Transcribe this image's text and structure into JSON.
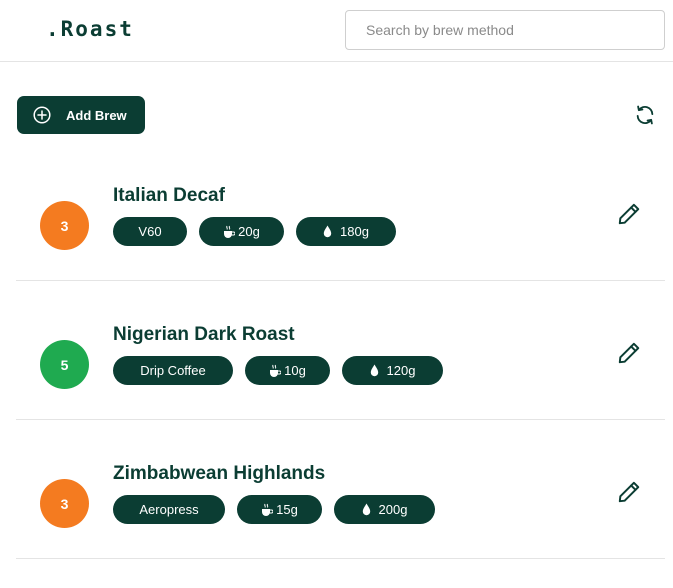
{
  "header": {
    "logo": ".Roast",
    "search_placeholder": "Search by brew method"
  },
  "toolbar": {
    "add_label": "Add Brew",
    "add_icon": "plus-circle-icon",
    "refresh_icon": "refresh-icon"
  },
  "colors": {
    "brand": "#0b3d33",
    "rating_orange": "#f47b20",
    "rating_green": "#1faa50"
  },
  "brews": [
    {
      "rating": "3",
      "rating_color": "#f47b20",
      "name": "Italian Decaf",
      "method": "V60",
      "coffee": "20g",
      "water": "180g"
    },
    {
      "rating": "5",
      "rating_color": "#1faa50",
      "name": "Nigerian Dark Roast",
      "method": "Drip Coffee",
      "coffee": "10g",
      "water": "120g"
    },
    {
      "rating": "3",
      "rating_color": "#f47b20",
      "name": "Zimbabwean Highlands",
      "method": "Aeropress",
      "coffee": "15g",
      "water": "200g"
    }
  ]
}
